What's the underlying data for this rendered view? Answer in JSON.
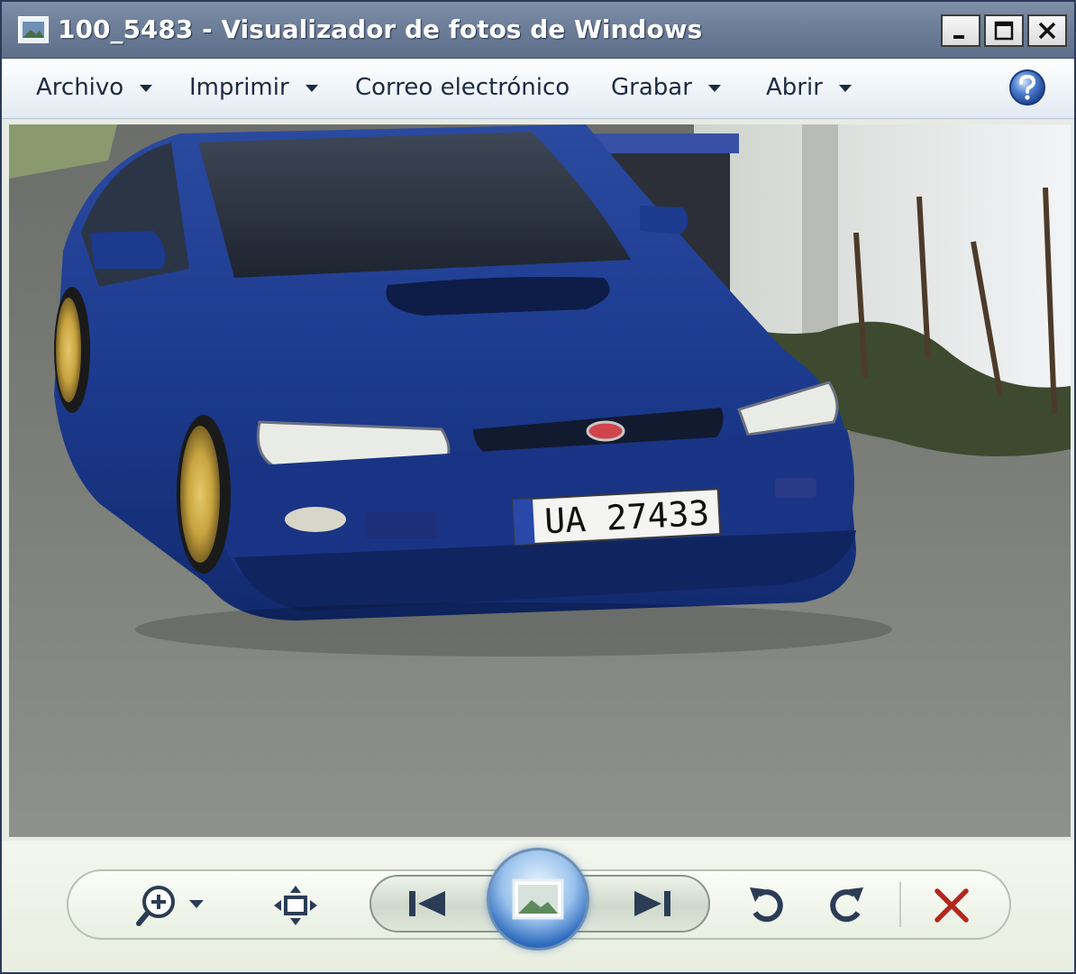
{
  "window": {
    "title": "100_5483 - Visualizador de fotos de Windows",
    "app_icon": "photo-viewer-icon",
    "caption_buttons": [
      "minimize-icon",
      "maximize-icon",
      "close-icon"
    ]
  },
  "menubar": {
    "items": [
      {
        "label": "Archivo",
        "has_dropdown": true
      },
      {
        "label": "Imprimir",
        "has_dropdown": true
      },
      {
        "label": "Correo electrónico",
        "has_dropdown": false
      },
      {
        "label": "Grabar",
        "has_dropdown": true
      },
      {
        "label": "Abrir",
        "has_dropdown": true
      }
    ],
    "help_icon": "help-icon"
  },
  "photo": {
    "plate_text": "UA 27433"
  },
  "controls": {
    "icons": [
      "zoom-icon",
      "fit-to-window-icon",
      "previous-icon",
      "slideshow-icon",
      "next-icon",
      "rotate-counterclockwise-icon",
      "rotate-clockwise-icon",
      "delete-icon"
    ]
  },
  "colors": {
    "titlebar": "#6d7e99",
    "car_blue": "#1c3a8e",
    "wheel_gold": "#c9a440",
    "delete_red": "#b3281f"
  }
}
